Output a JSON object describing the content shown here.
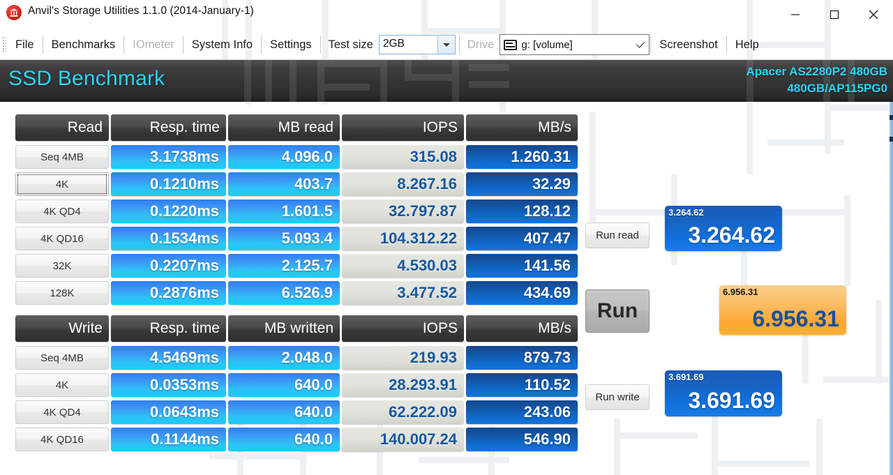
{
  "window": {
    "title": "Anvil's Storage Utilities 1.1.0 (2014-January-1)",
    "icon": "anvil-bank-icon",
    "minimize_label": "minimize-icon",
    "maximize_label": "maximize-icon",
    "close_label": "close-icon"
  },
  "menu": {
    "items": [
      {
        "label": "File",
        "disabled": false
      },
      {
        "label": "Benchmarks",
        "disabled": false
      },
      {
        "label": "IOmeter",
        "disabled": true
      },
      {
        "label": "System Info",
        "disabled": false
      },
      {
        "label": "Settings",
        "disabled": false
      }
    ],
    "test_size_label": "Test size",
    "test_size_value": "2GB",
    "drive_label": "Drive",
    "drive_value": "g: [volume]",
    "screenshot_label": "Screenshot",
    "help_label": "Help"
  },
  "banner": {
    "title": "SSD Benchmark",
    "device_line1": "Apacer AS2280P2 480GB",
    "device_line2": "480GB/AP115PG0",
    "accent_color": "#2ad6f5",
    "background_color": "#343434"
  },
  "read_table": {
    "headers": [
      "Read",
      "Resp. time",
      "MB read",
      "IOPS",
      "MB/s"
    ],
    "rows": [
      {
        "label": "Seq 4MB",
        "focused": false,
        "resp": "3.1738ms",
        "mb": "4.096.0",
        "iops": "315.08",
        "mbs": "1.260.31"
      },
      {
        "label": "4K",
        "focused": true,
        "resp": "0.1210ms",
        "mb": "403.7",
        "iops": "8.267.16",
        "mbs": "32.29"
      },
      {
        "label": "4K QD4",
        "focused": false,
        "resp": "0.1220ms",
        "mb": "1.601.5",
        "iops": "32.797.87",
        "mbs": "128.12"
      },
      {
        "label": "4K QD16",
        "focused": false,
        "resp": "0.1534ms",
        "mb": "5.093.4",
        "iops": "104.312.22",
        "mbs": "407.47"
      },
      {
        "label": "32K",
        "focused": false,
        "resp": "0.2207ms",
        "mb": "2.125.7",
        "iops": "4.530.03",
        "mbs": "141.56"
      },
      {
        "label": "128K",
        "focused": false,
        "resp": "0.2876ms",
        "mb": "6.526.9",
        "iops": "3.477.52",
        "mbs": "434.69"
      }
    ]
  },
  "write_table": {
    "headers": [
      "Write",
      "Resp. time",
      "MB written",
      "IOPS",
      "MB/s"
    ],
    "rows": [
      {
        "label": "Seq 4MB",
        "focused": false,
        "resp": "4.5469ms",
        "mb": "2.048.0",
        "iops": "219.93",
        "mbs": "879.73"
      },
      {
        "label": "4K",
        "focused": false,
        "resp": "0.0353ms",
        "mb": "640.0",
        "iops": "28.293.91",
        "mbs": "110.52"
      },
      {
        "label": "4K QD4",
        "focused": false,
        "resp": "0.0643ms",
        "mb": "640.0",
        "iops": "62.222.09",
        "mbs": "243.06"
      },
      {
        "label": "4K QD16",
        "focused": false,
        "resp": "0.1144ms",
        "mb": "640.0",
        "iops": "140.007.24",
        "mbs": "546.90"
      }
    ]
  },
  "controls": {
    "run_read_label": "Run read",
    "run_label": "Run",
    "run_write_label": "Run write"
  },
  "scores": {
    "read": {
      "small": "3.264.62",
      "big": "3.264.62",
      "color": "#1070da"
    },
    "total": {
      "small": "6.956.31",
      "big": "6.956.31",
      "color": "#fba832"
    },
    "write": {
      "small": "3.691.69",
      "big": "3.691.69",
      "color": "#1070da"
    }
  }
}
